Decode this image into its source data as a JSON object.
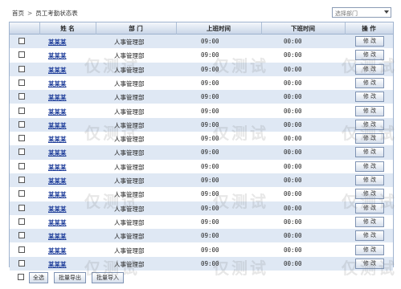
{
  "breadcrumb": [
    "首页",
    "员工考勤状态表"
  ],
  "breadcrumb_separator": ">",
  "department_select": {
    "value": "选择部门"
  },
  "table": {
    "headers": {
      "name": "姓 名",
      "dept": "部 门",
      "checkin": "上班时间",
      "checkout": "下班时间",
      "action": "操 作"
    },
    "rows": [
      {
        "name": "某某某",
        "dept": "人事管理部",
        "checkin": "09:00",
        "checkout": "00:00",
        "action": "修 改"
      },
      {
        "name": "某某某",
        "dept": "人事管理部",
        "checkin": "09:00",
        "checkout": "00:00",
        "action": "修 改"
      },
      {
        "name": "某某某",
        "dept": "人事管理部",
        "checkin": "09:00",
        "checkout": "00:00",
        "action": "修 改"
      },
      {
        "name": "某某某",
        "dept": "人事管理部",
        "checkin": "09:00",
        "checkout": "00:00",
        "action": "修 改"
      },
      {
        "name": "某某某",
        "dept": "人事管理部",
        "checkin": "09:00",
        "checkout": "00:00",
        "action": "修 改"
      },
      {
        "name": "某某某",
        "dept": "人事管理部",
        "checkin": "09:00",
        "checkout": "00:00",
        "action": "修 改"
      },
      {
        "name": "某某某",
        "dept": "人事管理部",
        "checkin": "09:00",
        "checkout": "00:00",
        "action": "修 改"
      },
      {
        "name": "某某某",
        "dept": "人事管理部",
        "checkin": "09:00",
        "checkout": "00:00",
        "action": "修 改"
      },
      {
        "name": "某某某",
        "dept": "人事管理部",
        "checkin": "09:00",
        "checkout": "00:00",
        "action": "修 改"
      },
      {
        "name": "某某某",
        "dept": "人事管理部",
        "checkin": "09:00",
        "checkout": "00:00",
        "action": "修 改"
      },
      {
        "name": "某某某",
        "dept": "人事管理部",
        "checkin": "09:00",
        "checkout": "00:00",
        "action": "修 改"
      },
      {
        "name": "某某某",
        "dept": "人事管理部",
        "checkin": "09:00",
        "checkout": "00:00",
        "action": "修 改"
      },
      {
        "name": "某某某",
        "dept": "人事管理部",
        "checkin": "09:00",
        "checkout": "00:00",
        "action": "修 改"
      },
      {
        "name": "某某某",
        "dept": "人事管理部",
        "checkin": "09:00",
        "checkout": "00:00",
        "action": "修 改"
      },
      {
        "name": "某某某",
        "dept": "人事管理部",
        "checkin": "09:00",
        "checkout": "00:00",
        "action": "修 改"
      },
      {
        "name": "某某某",
        "dept": "人事管理部",
        "checkin": "09:00",
        "checkout": "00:00",
        "action": "修 改"
      },
      {
        "name": "某某某",
        "dept": "人事管理部",
        "checkin": "09:00",
        "checkout": "00:00",
        "action": "修 改"
      }
    ]
  },
  "footer": {
    "select_all": "全选",
    "batch_export": "批量导出",
    "batch_import": "批量导入"
  },
  "watermark": "仅测试",
  "colors": {
    "header_bg": "#c9d6e8",
    "row_alt": "#dfe8f4",
    "link": "#1f3e9a",
    "border": "#9fb3cf"
  }
}
